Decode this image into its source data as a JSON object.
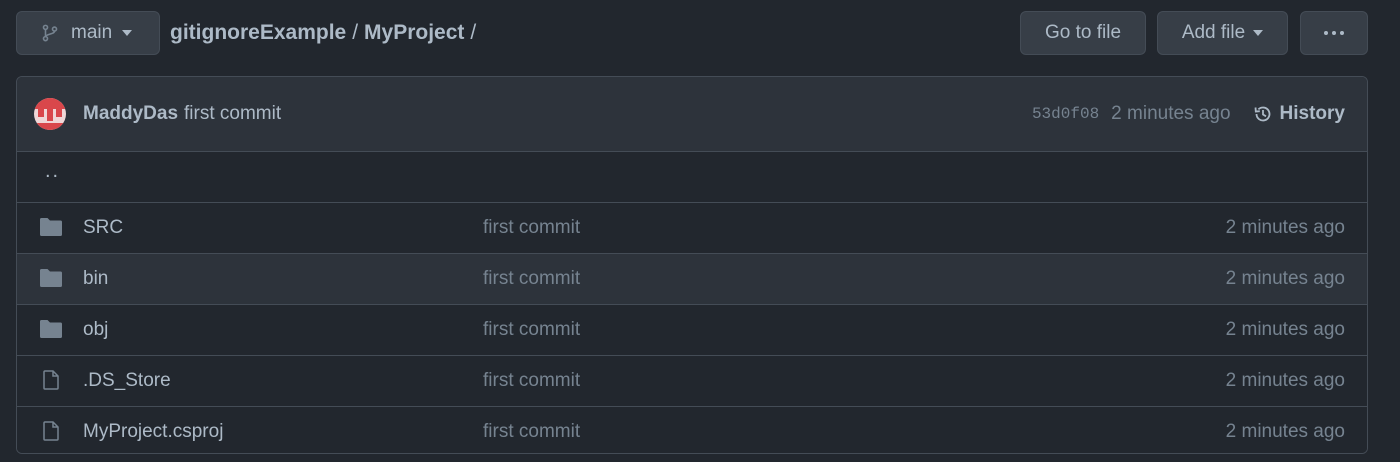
{
  "branch": {
    "name": "main",
    "icon": "git-branch-icon"
  },
  "breadcrumb": {
    "repo": "gitignoreExample",
    "sep": "/",
    "folder": "MyProject",
    "trailing": "/"
  },
  "buttons": {
    "goto": "Go to file",
    "add": "Add file",
    "more": "more-options-icon"
  },
  "commit": {
    "author": "MaddyDas",
    "message": "first commit",
    "sha": "53d0f08",
    "time": "2 minutes ago",
    "history": "History"
  },
  "parent_dir": "..",
  "files": [
    {
      "name": "SRC",
      "type": "folder",
      "message": "first commit",
      "time": "2 minutes ago"
    },
    {
      "name": "bin",
      "type": "folder",
      "message": "first commit",
      "time": "2 minutes ago"
    },
    {
      "name": "obj",
      "type": "folder",
      "message": "first commit",
      "time": "2 minutes ago"
    },
    {
      "name": ".DS_Store",
      "type": "file",
      "message": "first commit",
      "time": "2 minutes ago"
    },
    {
      "name": "MyProject.csproj",
      "type": "file",
      "message": "first commit",
      "time": "2 minutes ago"
    }
  ],
  "colors": {
    "background": "#22272e",
    "border": "#444c56",
    "text": "#adbac7",
    "muted": "#768390"
  }
}
